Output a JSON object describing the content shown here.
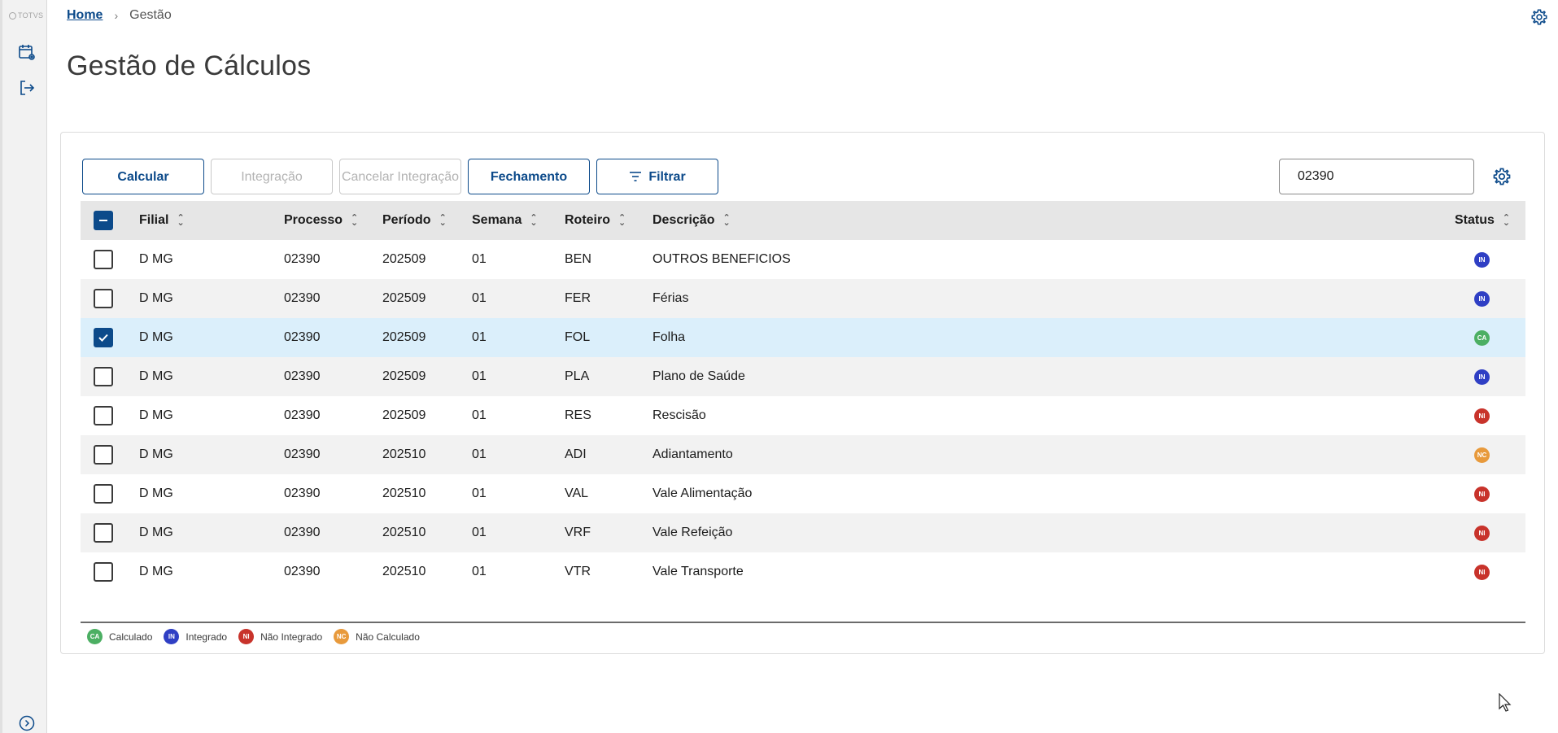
{
  "sidebar": {
    "logo_text": "TOTVS"
  },
  "breadcrumb": {
    "home": "Home",
    "current": "Gestão"
  },
  "page": {
    "title": "Gestão de Cálculos"
  },
  "toolbar": {
    "calcular": "Calcular",
    "integracao": "Integração",
    "cancelar_integracao": "Cancelar Integração",
    "fechamento": "Fechamento",
    "filtrar": "Filtrar"
  },
  "search": {
    "value": "02390"
  },
  "table": {
    "headers": {
      "filial": "Filial",
      "processo": "Processo",
      "periodo": "Período",
      "semana": "Semana",
      "roteiro": "Roteiro",
      "descricao": "Descrição",
      "status": "Status"
    },
    "rows": [
      {
        "filial": "D MG",
        "processo": "02390",
        "periodo": "202509",
        "semana": "01",
        "roteiro": "BEN",
        "descricao": "OUTROS BENEFICIOS",
        "status": "IN",
        "selected": false
      },
      {
        "filial": "D MG",
        "processo": "02390",
        "periodo": "202509",
        "semana": "01",
        "roteiro": "FER",
        "descricao": "Férias",
        "status": "IN",
        "selected": false
      },
      {
        "filial": "D MG",
        "processo": "02390",
        "periodo": "202509",
        "semana": "01",
        "roteiro": "FOL",
        "descricao": "Folha",
        "status": "CA",
        "selected": true
      },
      {
        "filial": "D MG",
        "processo": "02390",
        "periodo": "202509",
        "semana": "01",
        "roteiro": "PLA",
        "descricao": "Plano de Saúde",
        "status": "IN",
        "selected": false
      },
      {
        "filial": "D MG",
        "processo": "02390",
        "periodo": "202509",
        "semana": "01",
        "roteiro": "RES",
        "descricao": "Rescisão",
        "status": "NI",
        "selected": false
      },
      {
        "filial": "D MG",
        "processo": "02390",
        "periodo": "202510",
        "semana": "01",
        "roteiro": "ADI",
        "descricao": "Adiantamento",
        "status": "NC",
        "selected": false
      },
      {
        "filial": "D MG",
        "processo": "02390",
        "periodo": "202510",
        "semana": "01",
        "roteiro": "VAL",
        "descricao": "Vale Alimentação",
        "status": "NI",
        "selected": false
      },
      {
        "filial": "D MG",
        "processo": "02390",
        "periodo": "202510",
        "semana": "01",
        "roteiro": "VRF",
        "descricao": "Vale Refeição",
        "status": "NI",
        "selected": false
      },
      {
        "filial": "D MG",
        "processo": "02390",
        "periodo": "202510",
        "semana": "01",
        "roteiro": "VTR",
        "descricao": "Vale Transporte",
        "status": "NI",
        "selected": false
      }
    ]
  },
  "status_colors": {
    "CA": "#4caf63",
    "IN": "#2f3fc4",
    "NI": "#c8332b",
    "NC": "#e89a3c"
  },
  "legend": [
    {
      "code": "CA",
      "label": "Calculado"
    },
    {
      "code": "IN",
      "label": "Integrado"
    },
    {
      "code": "NI",
      "label": "Não Integrado"
    },
    {
      "code": "NC",
      "label": "Não Calculado"
    }
  ],
  "accent_color": "#0c4a8a"
}
